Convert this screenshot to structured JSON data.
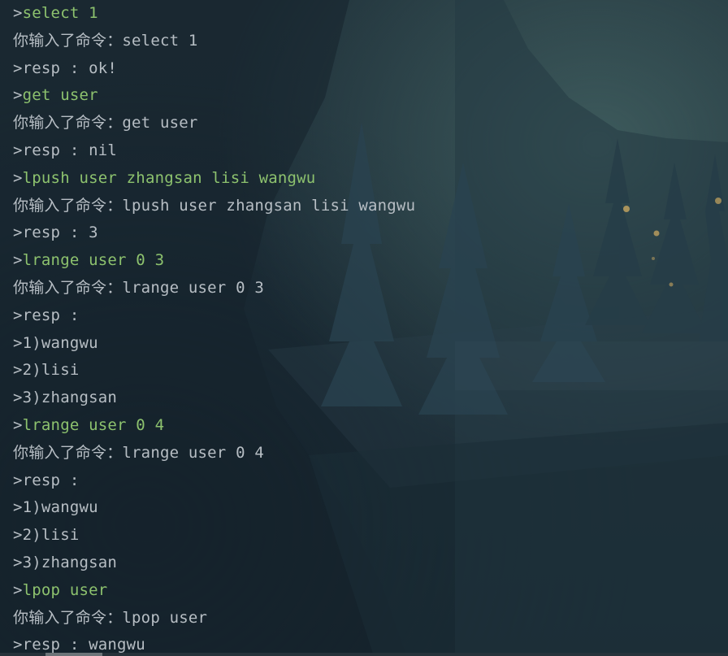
{
  "console": {
    "lines": [
      {
        "kind": "cmd",
        "prefix": ">",
        "text": "select 1"
      },
      {
        "kind": "echo",
        "prefix": "",
        "text": "你输入了命令：select 1"
      },
      {
        "kind": "out",
        "prefix": "",
        "text": ">resp : ok!"
      },
      {
        "kind": "cmd",
        "prefix": ">",
        "text": "get user"
      },
      {
        "kind": "echo",
        "prefix": "",
        "text": "你输入了命令：get user"
      },
      {
        "kind": "out",
        "prefix": "",
        "text": ">resp : nil"
      },
      {
        "kind": "cmd",
        "prefix": ">",
        "text": "lpush user zhangsan lisi wangwu"
      },
      {
        "kind": "echo",
        "prefix": "",
        "text": "你输入了命令：lpush user zhangsan lisi wangwu"
      },
      {
        "kind": "out",
        "prefix": "",
        "text": ">resp : 3"
      },
      {
        "kind": "cmd",
        "prefix": ">",
        "text": "lrange user 0 3"
      },
      {
        "kind": "echo",
        "prefix": "",
        "text": "你输入了命令：lrange user 0 3"
      },
      {
        "kind": "out",
        "prefix": "",
        "text": ">resp :"
      },
      {
        "kind": "out",
        "prefix": "",
        "text": ">1)wangwu"
      },
      {
        "kind": "out",
        "prefix": "",
        "text": ">2)lisi"
      },
      {
        "kind": "out",
        "prefix": "",
        "text": ">3)zhangsan"
      },
      {
        "kind": "cmd",
        "prefix": ">",
        "text": "lrange user 0 4"
      },
      {
        "kind": "echo",
        "prefix": "",
        "text": "你输入了命令：lrange user 0 4"
      },
      {
        "kind": "out",
        "prefix": "",
        "text": ">resp :"
      },
      {
        "kind": "out",
        "prefix": "",
        "text": ">1)wangwu"
      },
      {
        "kind": "out",
        "prefix": "",
        "text": ">2)lisi"
      },
      {
        "kind": "out",
        "prefix": "",
        "text": ">3)zhangsan"
      },
      {
        "kind": "cmd",
        "prefix": ">",
        "text": "lpop user"
      },
      {
        "kind": "echo",
        "prefix": "",
        "text": "你输入了命令：lpop user"
      },
      {
        "kind": "out",
        "prefix": "",
        "text": ">resp : wangwu"
      }
    ]
  },
  "colors": {
    "command": "#8dc26e",
    "output": "#b7bec4",
    "background": "#1d2e38"
  }
}
